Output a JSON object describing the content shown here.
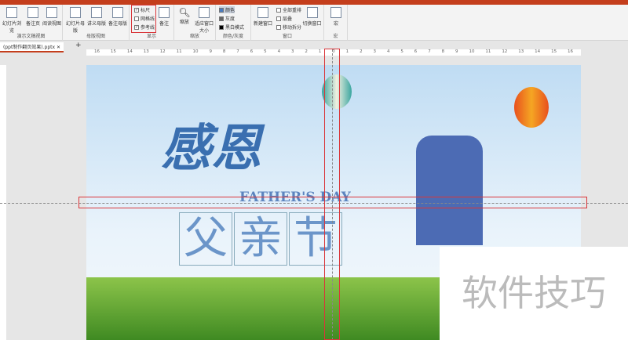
{
  "ribbon": {
    "presentation_views": {
      "label": "演示文稿视图",
      "items": [
        "幻灯片浏览",
        "备注页",
        "阅读视图"
      ]
    },
    "master_views": {
      "label": "母版视图",
      "items": [
        "幻灯片母版",
        "讲义母版",
        "备注母版"
      ]
    },
    "show": {
      "label": "显示",
      "ruler": "标尺",
      "grid": "网格线",
      "guides": "参考线",
      "notes": "备注",
      "ruler_checked": true,
      "grid_checked": false,
      "guides_checked": true
    },
    "zoom": {
      "label": "缩放",
      "zoom": "缩放",
      "fit": "适应窗口大小"
    },
    "color": {
      "label": "颜色/灰度",
      "items": [
        "颜色",
        "灰度",
        "黑白模式"
      ]
    },
    "window": {
      "label": "窗口",
      "new": "新建窗口",
      "arrange": "全部重排",
      "cascade": "层叠",
      "move": "移动拆分",
      "switch": "切换窗口"
    },
    "macros": {
      "label": "宏",
      "item": "宏"
    }
  },
  "tab": {
    "name": "(ppt制作翻页效果).pptx"
  },
  "ruler": [
    "16",
    "15",
    "14",
    "13",
    "12",
    "11",
    "10",
    "9",
    "8",
    "7",
    "6",
    "5",
    "4",
    "3",
    "2",
    "1",
    "0",
    "1",
    "2",
    "3",
    "4",
    "5",
    "6",
    "7",
    "8",
    "9",
    "10",
    "11",
    "12",
    "13",
    "14",
    "15",
    "16"
  ],
  "slide": {
    "title": "感恩",
    "subtitle": "FATHER'S DAY",
    "chars": [
      "父",
      "亲",
      "节"
    ]
  },
  "watermark": "软件技巧"
}
